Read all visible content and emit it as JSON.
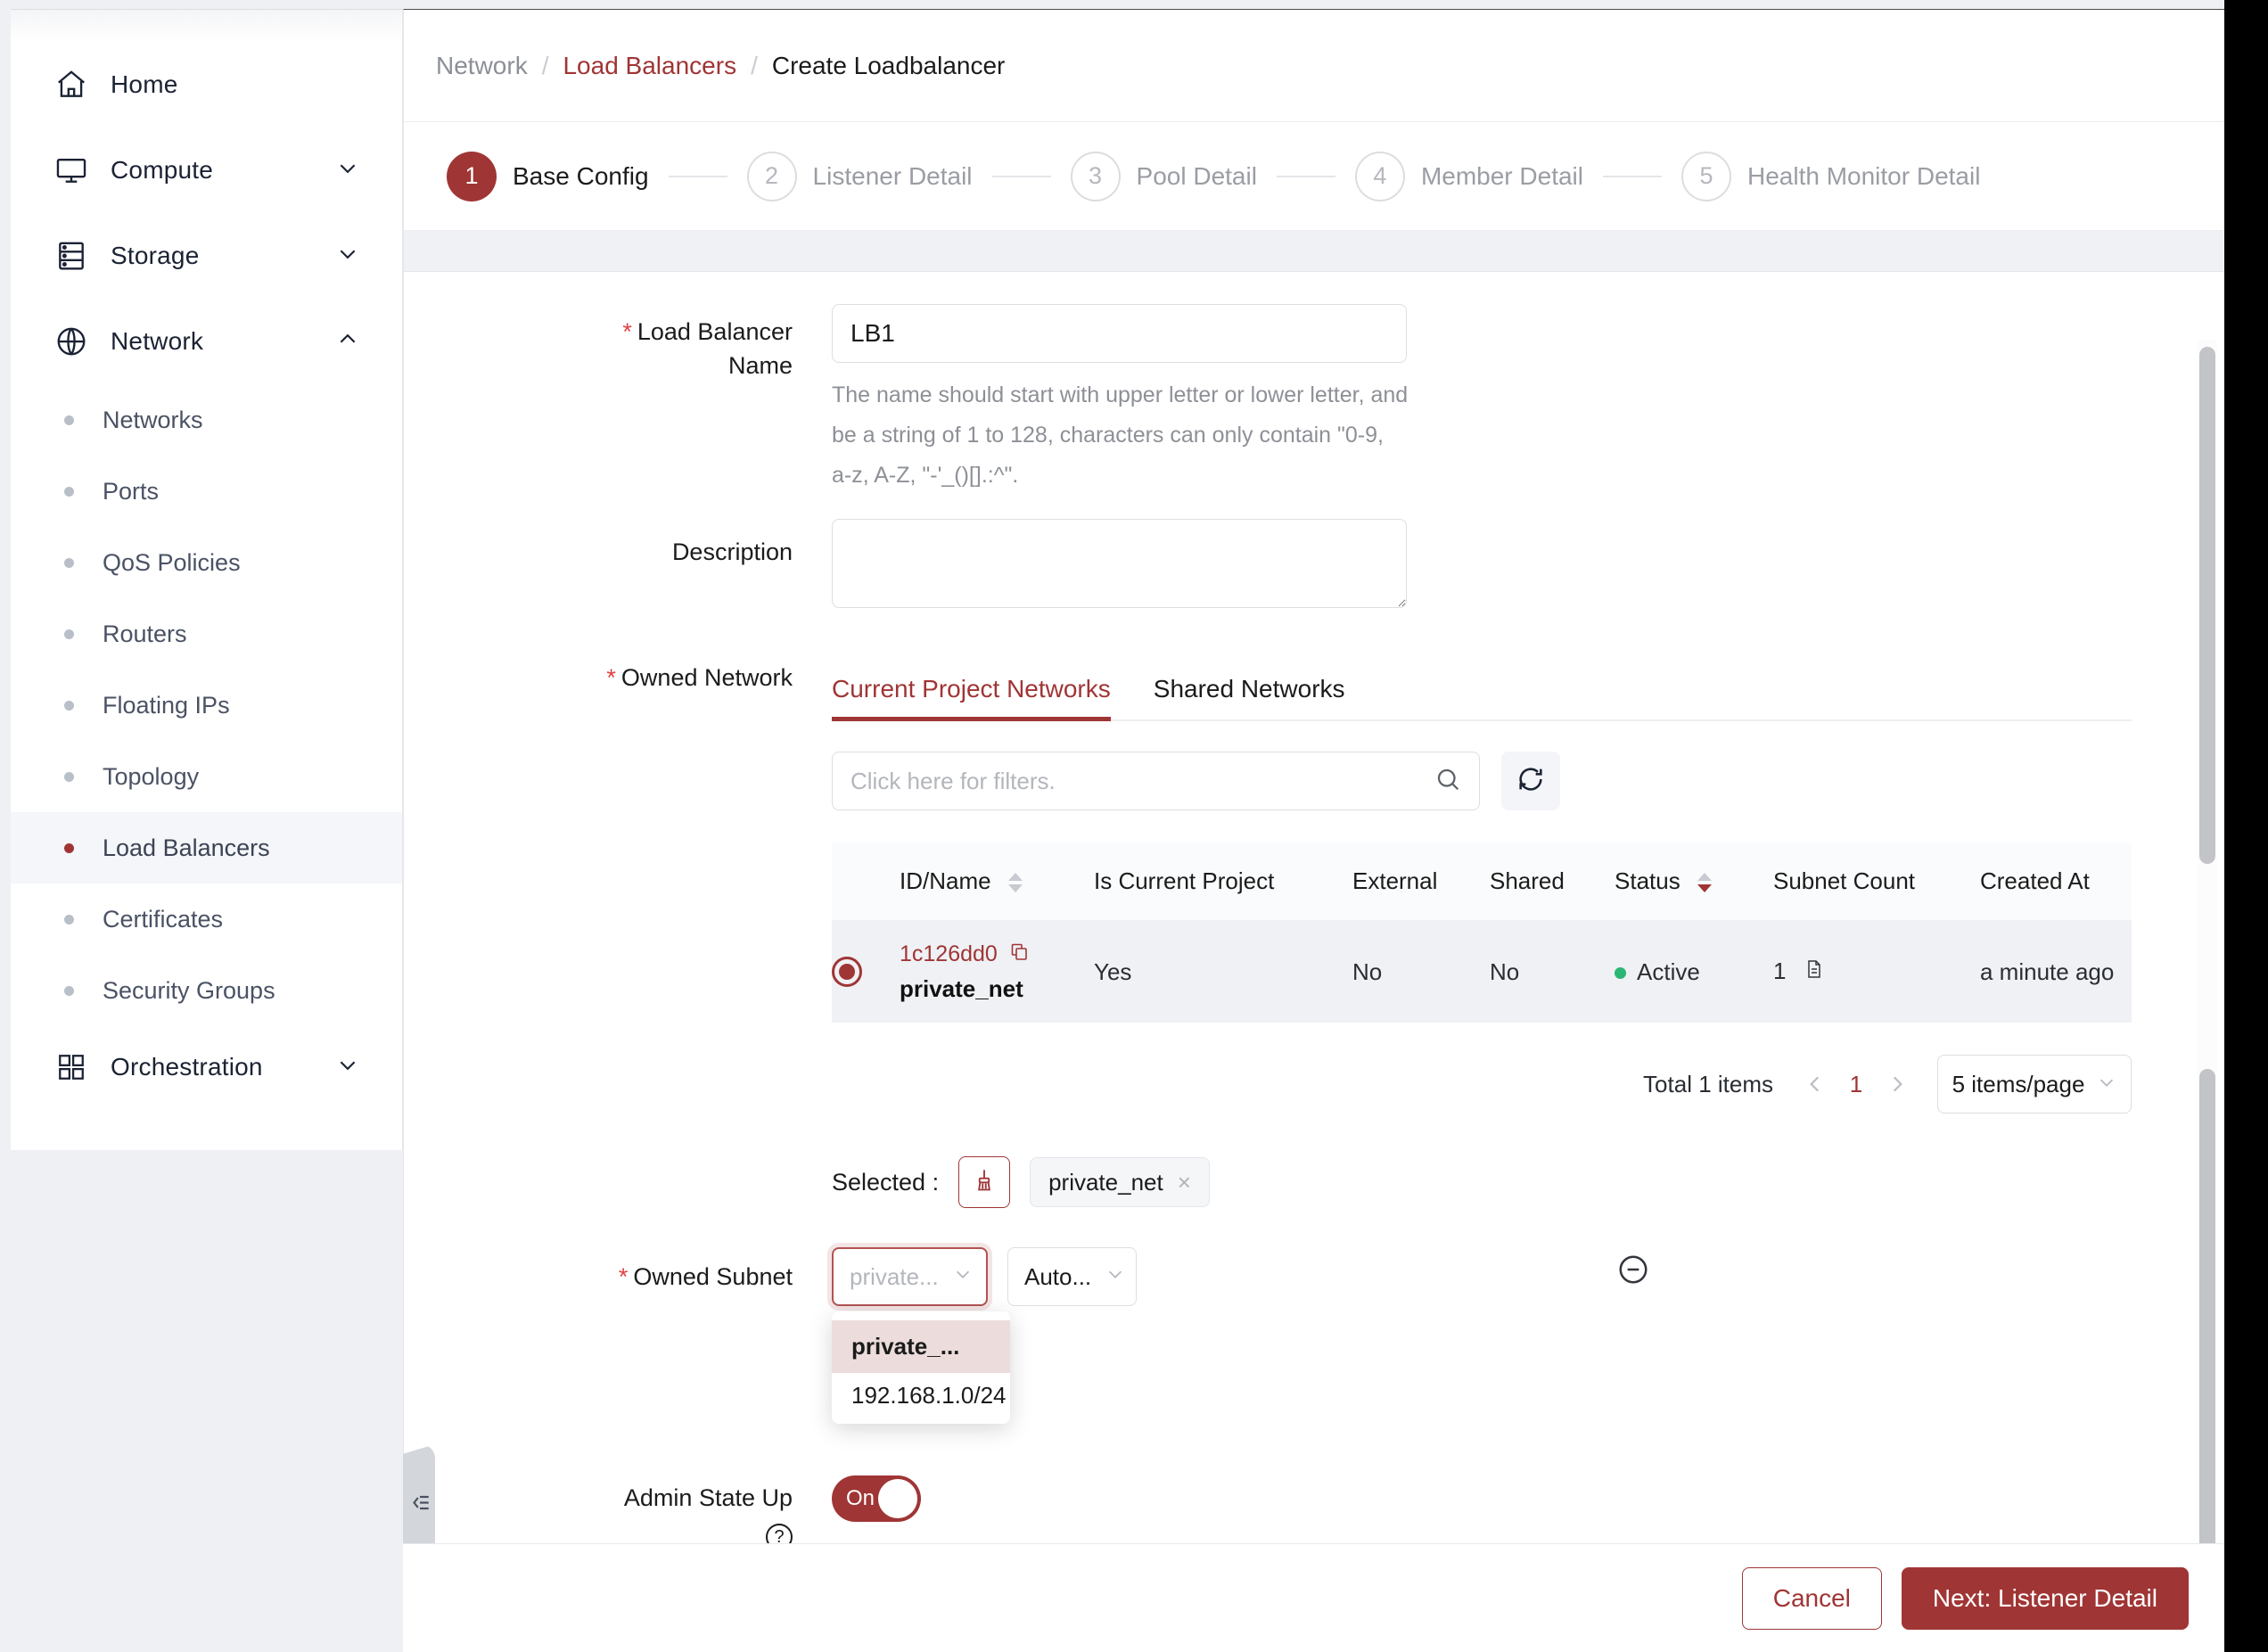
{
  "sidebar": {
    "items": [
      {
        "label": "Home",
        "icon": "home-icon",
        "expandable": false
      },
      {
        "label": "Compute",
        "icon": "monitor-icon",
        "expandable": true,
        "chevron": "down"
      },
      {
        "label": "Storage",
        "icon": "server-icon",
        "expandable": true,
        "chevron": "down"
      },
      {
        "label": "Network",
        "icon": "globe-icon",
        "expandable": true,
        "chevron": "up"
      }
    ],
    "network_children": [
      {
        "label": "Networks",
        "active": false
      },
      {
        "label": "Ports",
        "active": false
      },
      {
        "label": "QoS Policies",
        "active": false
      },
      {
        "label": "Routers",
        "active": false
      },
      {
        "label": "Floating IPs",
        "active": false
      },
      {
        "label": "Topology",
        "active": false
      },
      {
        "label": "Load Balancers",
        "active": true
      },
      {
        "label": "Certificates",
        "active": false
      },
      {
        "label": "Security Groups",
        "active": false
      }
    ],
    "orchestration": {
      "label": "Orchestration",
      "icon": "grid-icon",
      "chevron": "down"
    },
    "collapse_handle": "collapse-sidebar-icon"
  },
  "breadcrumb": {
    "root": "Network",
    "sep": "/",
    "parent": "Load Balancers",
    "current": "Create Loadbalancer"
  },
  "stepper": {
    "steps": [
      {
        "num": "1",
        "label": "Base Config",
        "state": "done"
      },
      {
        "num": "2",
        "label": "Listener Detail",
        "state": "todo"
      },
      {
        "num": "3",
        "label": "Pool Detail",
        "state": "todo"
      },
      {
        "num": "4",
        "label": "Member Detail",
        "state": "todo"
      },
      {
        "num": "5",
        "label": "Health Monitor Detail",
        "state": "todo"
      }
    ]
  },
  "form": {
    "lb_name": {
      "label_line1": "Load Balancer",
      "label_line2": "Name",
      "value": "LB1",
      "placeholder": "",
      "hint": "The name should start with upper letter or lower letter, and be a string of 1 to 128, characters can only contain \"0-9, a-z, A-Z, \"-'_()[].:^\"."
    },
    "description": {
      "label": "Description",
      "value": "",
      "placeholder": ""
    },
    "owned_network": {
      "label": "Owned Network",
      "tabs": [
        {
          "label": "Current Project Networks",
          "active": true
        },
        {
          "label": "Shared Networks",
          "active": false
        }
      ],
      "filter_placeholder": "Click here for filters.",
      "filter_value": "",
      "refresh_icon": "refresh-icon",
      "search_icon": "search-icon"
    },
    "owned_subnet": {
      "label": "Owned Subnet",
      "subnet_select": {
        "placeholder": "private...",
        "value": ""
      },
      "ip_select": {
        "value": "Auto..."
      },
      "dropdown": {
        "open": true,
        "options": [
          {
            "label": "private_...",
            "highlighted": true
          },
          {
            "label": "192.168.1.0/24",
            "highlighted": false
          }
        ]
      },
      "remove_icon": "minus-circle-icon"
    },
    "admin_state": {
      "label": "Admin State Up",
      "help_icon": "question-mark-icon",
      "toggle_label": "On",
      "toggle_on": true
    }
  },
  "table": {
    "columns": [
      {
        "label": "ID/Name",
        "sortable": true,
        "sort": "none"
      },
      {
        "label": "Is Current Project",
        "sortable": false
      },
      {
        "label": "External",
        "sortable": false
      },
      {
        "label": "Shared",
        "sortable": false
      },
      {
        "label": "Status",
        "sortable": true,
        "sort": "desc"
      },
      {
        "label": "Subnet Count",
        "sortable": false
      },
      {
        "label": "Created At",
        "sortable": false
      }
    ],
    "rows": [
      {
        "selected": true,
        "id": "1c126dd0",
        "copy_icon": "copy-icon",
        "name": "private_net",
        "is_current_project": "Yes",
        "external": "No",
        "shared": "No",
        "status": "Active",
        "status_color": "#2bb673",
        "subnet_count": "1",
        "subnet_icon": "document-icon",
        "created_at": "a minute ago"
      }
    ]
  },
  "pagination": {
    "total": "Total 1 items",
    "prev_icon": "chevron-left-icon",
    "current_page": "1",
    "next_icon": "chevron-right-icon",
    "page_size": "5 items/page",
    "page_size_caret": "chevron-down-icon"
  },
  "selected": {
    "label": "Selected :",
    "clear_icon": "broom-icon",
    "chips": [
      {
        "label": "private_net",
        "remove": "×"
      }
    ]
  },
  "footer": {
    "cancel": "Cancel",
    "next": "Next: Listener Detail"
  },
  "colors": {
    "accent": "#a03535",
    "required": "#e04141",
    "status_active": "#2bb673"
  }
}
